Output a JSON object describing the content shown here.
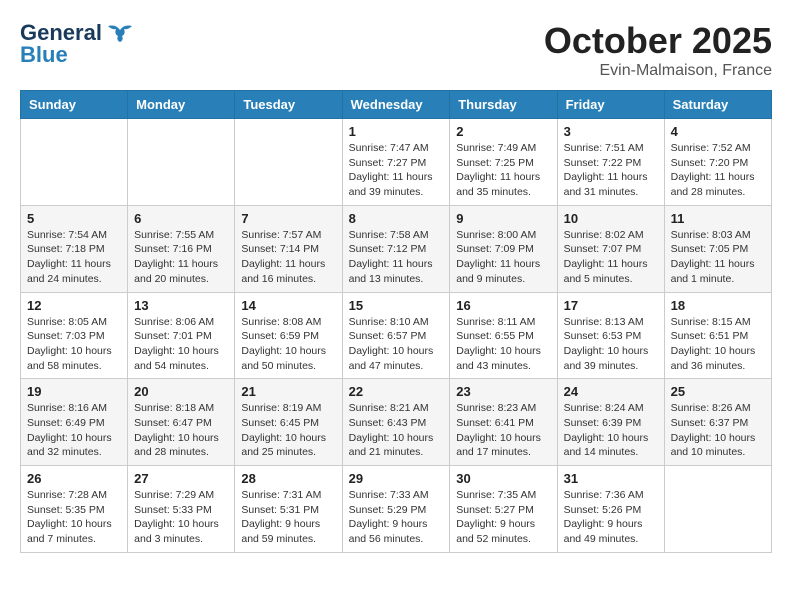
{
  "logo": {
    "general": "General",
    "blue": "Blue"
  },
  "title": "October 2025",
  "subtitle": "Evin-Malmaison, France",
  "headers": [
    "Sunday",
    "Monday",
    "Tuesday",
    "Wednesday",
    "Thursday",
    "Friday",
    "Saturday"
  ],
  "weeks": [
    [
      {
        "day": "",
        "info": ""
      },
      {
        "day": "",
        "info": ""
      },
      {
        "day": "",
        "info": ""
      },
      {
        "day": "1",
        "info": "Sunrise: 7:47 AM\nSunset: 7:27 PM\nDaylight: 11 hours\nand 39 minutes."
      },
      {
        "day": "2",
        "info": "Sunrise: 7:49 AM\nSunset: 7:25 PM\nDaylight: 11 hours\nand 35 minutes."
      },
      {
        "day": "3",
        "info": "Sunrise: 7:51 AM\nSunset: 7:22 PM\nDaylight: 11 hours\nand 31 minutes."
      },
      {
        "day": "4",
        "info": "Sunrise: 7:52 AM\nSunset: 7:20 PM\nDaylight: 11 hours\nand 28 minutes."
      }
    ],
    [
      {
        "day": "5",
        "info": "Sunrise: 7:54 AM\nSunset: 7:18 PM\nDaylight: 11 hours\nand 24 minutes."
      },
      {
        "day": "6",
        "info": "Sunrise: 7:55 AM\nSunset: 7:16 PM\nDaylight: 11 hours\nand 20 minutes."
      },
      {
        "day": "7",
        "info": "Sunrise: 7:57 AM\nSunset: 7:14 PM\nDaylight: 11 hours\nand 16 minutes."
      },
      {
        "day": "8",
        "info": "Sunrise: 7:58 AM\nSunset: 7:12 PM\nDaylight: 11 hours\nand 13 minutes."
      },
      {
        "day": "9",
        "info": "Sunrise: 8:00 AM\nSunset: 7:09 PM\nDaylight: 11 hours\nand 9 minutes."
      },
      {
        "day": "10",
        "info": "Sunrise: 8:02 AM\nSunset: 7:07 PM\nDaylight: 11 hours\nand 5 minutes."
      },
      {
        "day": "11",
        "info": "Sunrise: 8:03 AM\nSunset: 7:05 PM\nDaylight: 11 hours\nand 1 minute."
      }
    ],
    [
      {
        "day": "12",
        "info": "Sunrise: 8:05 AM\nSunset: 7:03 PM\nDaylight: 10 hours\nand 58 minutes."
      },
      {
        "day": "13",
        "info": "Sunrise: 8:06 AM\nSunset: 7:01 PM\nDaylight: 10 hours\nand 54 minutes."
      },
      {
        "day": "14",
        "info": "Sunrise: 8:08 AM\nSunset: 6:59 PM\nDaylight: 10 hours\nand 50 minutes."
      },
      {
        "day": "15",
        "info": "Sunrise: 8:10 AM\nSunset: 6:57 PM\nDaylight: 10 hours\nand 47 minutes."
      },
      {
        "day": "16",
        "info": "Sunrise: 8:11 AM\nSunset: 6:55 PM\nDaylight: 10 hours\nand 43 minutes."
      },
      {
        "day": "17",
        "info": "Sunrise: 8:13 AM\nSunset: 6:53 PM\nDaylight: 10 hours\nand 39 minutes."
      },
      {
        "day": "18",
        "info": "Sunrise: 8:15 AM\nSunset: 6:51 PM\nDaylight: 10 hours\nand 36 minutes."
      }
    ],
    [
      {
        "day": "19",
        "info": "Sunrise: 8:16 AM\nSunset: 6:49 PM\nDaylight: 10 hours\nand 32 minutes."
      },
      {
        "day": "20",
        "info": "Sunrise: 8:18 AM\nSunset: 6:47 PM\nDaylight: 10 hours\nand 28 minutes."
      },
      {
        "day": "21",
        "info": "Sunrise: 8:19 AM\nSunset: 6:45 PM\nDaylight: 10 hours\nand 25 minutes."
      },
      {
        "day": "22",
        "info": "Sunrise: 8:21 AM\nSunset: 6:43 PM\nDaylight: 10 hours\nand 21 minutes."
      },
      {
        "day": "23",
        "info": "Sunrise: 8:23 AM\nSunset: 6:41 PM\nDaylight: 10 hours\nand 17 minutes."
      },
      {
        "day": "24",
        "info": "Sunrise: 8:24 AM\nSunset: 6:39 PM\nDaylight: 10 hours\nand 14 minutes."
      },
      {
        "day": "25",
        "info": "Sunrise: 8:26 AM\nSunset: 6:37 PM\nDaylight: 10 hours\nand 10 minutes."
      }
    ],
    [
      {
        "day": "26",
        "info": "Sunrise: 7:28 AM\nSunset: 5:35 PM\nDaylight: 10 hours\nand 7 minutes."
      },
      {
        "day": "27",
        "info": "Sunrise: 7:29 AM\nSunset: 5:33 PM\nDaylight: 10 hours\nand 3 minutes."
      },
      {
        "day": "28",
        "info": "Sunrise: 7:31 AM\nSunset: 5:31 PM\nDaylight: 9 hours\nand 59 minutes."
      },
      {
        "day": "29",
        "info": "Sunrise: 7:33 AM\nSunset: 5:29 PM\nDaylight: 9 hours\nand 56 minutes."
      },
      {
        "day": "30",
        "info": "Sunrise: 7:35 AM\nSunset: 5:27 PM\nDaylight: 9 hours\nand 52 minutes."
      },
      {
        "day": "31",
        "info": "Sunrise: 7:36 AM\nSunset: 5:26 PM\nDaylight: 9 hours\nand 49 minutes."
      },
      {
        "day": "",
        "info": ""
      }
    ]
  ]
}
